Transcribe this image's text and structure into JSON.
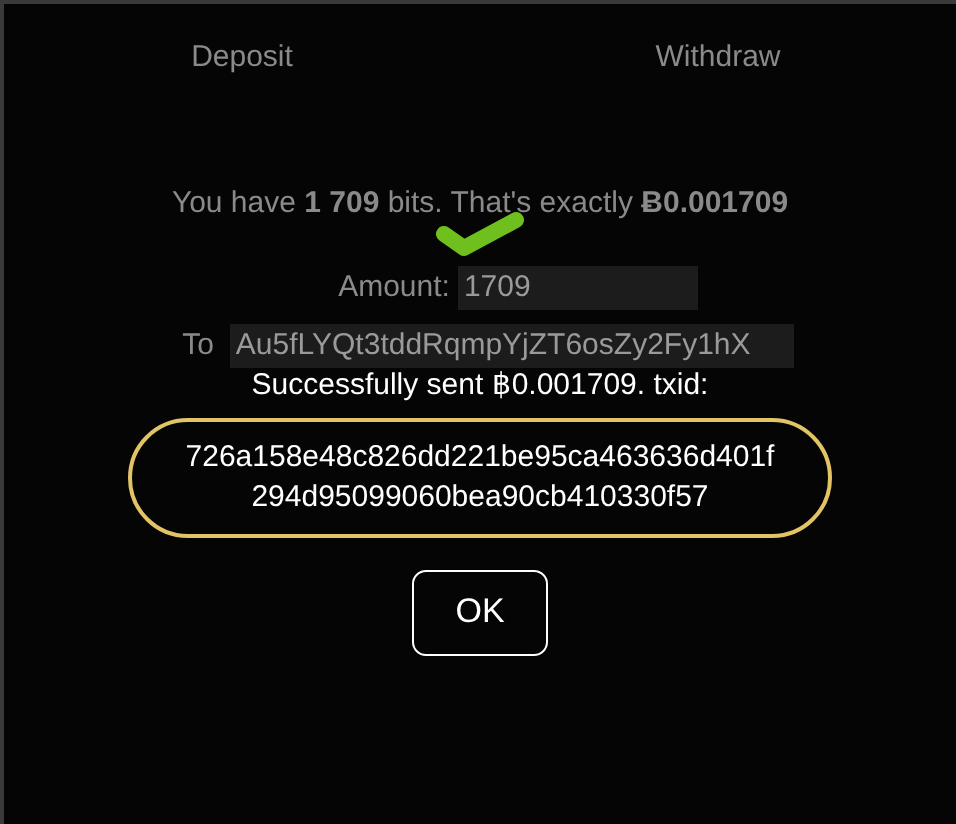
{
  "tabs": [
    {
      "label": "Deposit"
    },
    {
      "label": "Withdraw"
    }
  ],
  "balance": "You have **1 709** bits. That's exactly **Ƀ0.001709**",
  "amount": {
    "label": "Amount:",
    "value": "1709"
  },
  "to": {
    "label": "To",
    "value": "Au5fLYQt3tddRqmpYjZT6osZy2Fy1hX"
  },
  "dialog": {
    "message": "Successfully sent ฿0.001709. txid:",
    "txid": "726a158e48c826dd221be95ca463636d401f 294d95099060bea90cb410330f57",
    "button": "OK"
  }
}
